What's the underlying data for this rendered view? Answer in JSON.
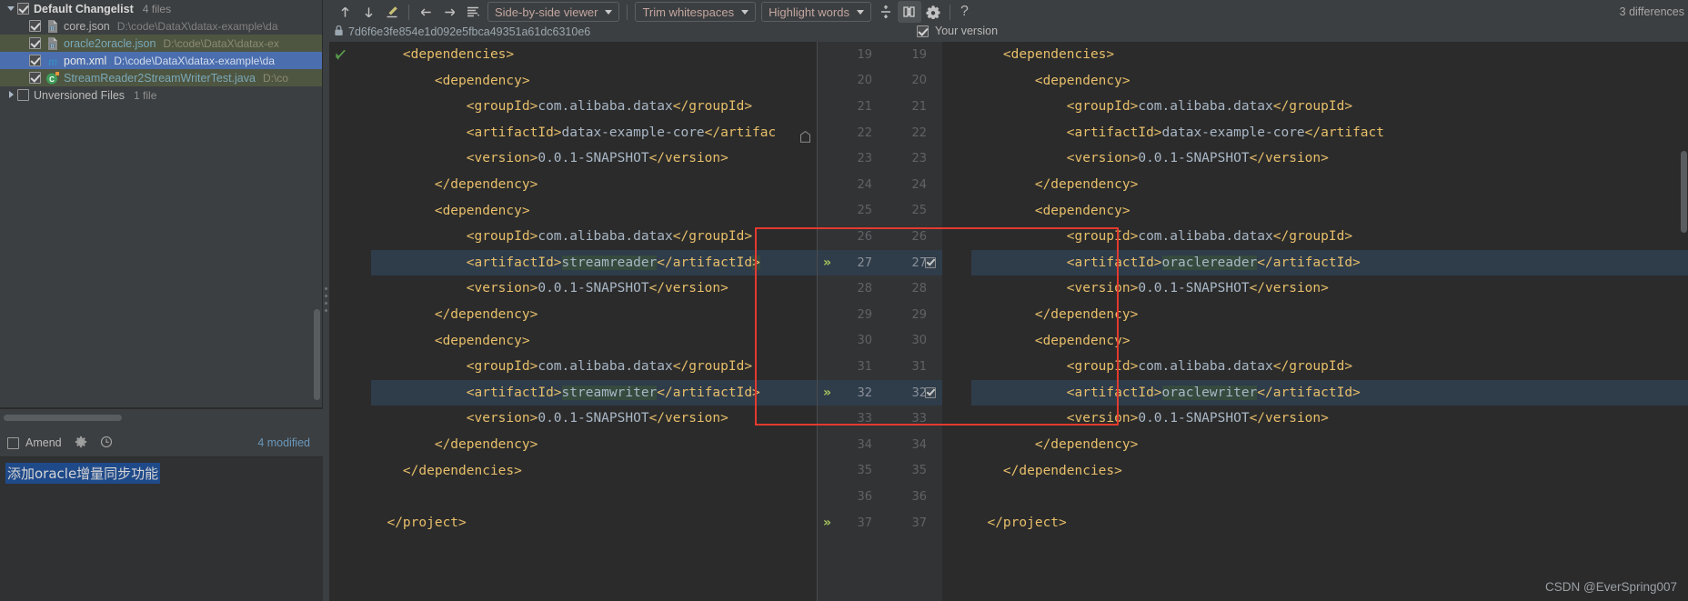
{
  "changelist": {
    "title": "Default Changelist",
    "count": "4 files",
    "expander": "chevron-down",
    "files": [
      {
        "name": "core.json",
        "path": "D:\\code\\DataX\\datax-example\\da",
        "icon": "json-file-icon",
        "state": "normal",
        "checked": true
      },
      {
        "name": "oracle2oracle.json",
        "path": "D:\\code\\DataX\\datax-ex",
        "icon": "json-file-icon",
        "state": "green",
        "checked": true
      },
      {
        "name": "pom.xml",
        "path": "D:\\code\\DataX\\datax-example\\da",
        "icon": "maven-file-icon",
        "state": "selected",
        "checked": true
      },
      {
        "name": "StreamReader2StreamWriterTest.java",
        "path": "D:\\co",
        "icon": "java-class-icon",
        "state": "green",
        "checked": true
      }
    ],
    "unversioned": {
      "label": "Unversioned Files",
      "count": "1 file",
      "expander": "chevron-right",
      "checked": false
    }
  },
  "commit": {
    "amend_label": "Amend",
    "amend_checked": false,
    "gear_icon": "gear-icon",
    "history_icon": "clock-icon",
    "modified_text": "4 modified",
    "message": "添加oracle增量同步功能"
  },
  "toolbar": {
    "prev_diff_icon": "arrow-up-icon",
    "next_diff_icon": "arrow-down-icon",
    "edit_icon": "pencil-icon",
    "back_icon": "arrow-left-icon",
    "forward_icon": "arrow-right-icon",
    "lines_icon": "list-lines-icon",
    "viewer_mode": "Side-by-side viewer",
    "whitespace_mode": "Trim whitespaces",
    "highlight_mode": "Highlight words",
    "collapse_icon": "collapse-unchanged-icon",
    "columns_icon": "synchronize-scroll-icon",
    "settings_icon": "gear-icon",
    "help_icon": "help-icon",
    "differences": "3 differences"
  },
  "diff_header": {
    "left_revision": "7d6f6e3fe854e1d092e5fbca49351a61dc6310e6",
    "left_lock_icon": "lock-icon",
    "right_label": "Your version",
    "right_checked": true
  },
  "diff": {
    "left_lines": [
      {
        "num": "19",
        "indent": 2,
        "segs": [
          {
            "t": "tag",
            "v": "<dependencies>"
          }
        ]
      },
      {
        "num": "20",
        "indent": 4,
        "segs": [
          {
            "t": "tag",
            "v": "<dependency>"
          }
        ]
      },
      {
        "num": "21",
        "indent": 6,
        "segs": [
          {
            "t": "tag",
            "v": "<groupId>"
          },
          {
            "t": "txt",
            "v": "com.alibaba.datax"
          },
          {
            "t": "tag",
            "v": "</groupId>"
          }
        ]
      },
      {
        "num": "22",
        "indent": 6,
        "segs": [
          {
            "t": "tag",
            "v": "<artifactId>"
          },
          {
            "t": "txt",
            "v": "datax-example-core"
          },
          {
            "t": "tag",
            "v": "</artifac"
          }
        ]
      },
      {
        "num": "23",
        "indent": 6,
        "segs": [
          {
            "t": "tag",
            "v": "<version>"
          },
          {
            "t": "txt",
            "v": "0.0.1-SNAPSHOT"
          },
          {
            "t": "tag",
            "v": "</version>"
          }
        ]
      },
      {
        "num": "24",
        "indent": 4,
        "segs": [
          {
            "t": "tag",
            "v": "</dependency>"
          }
        ]
      },
      {
        "num": "25",
        "indent": 4,
        "segs": [
          {
            "t": "tag",
            "v": "<dependency>"
          }
        ]
      },
      {
        "num": "26",
        "indent": 6,
        "segs": [
          {
            "t": "tag",
            "v": "<groupId>"
          },
          {
            "t": "txt",
            "v": "com.alibaba.datax"
          },
          {
            "t": "tag",
            "v": "</groupId>"
          }
        ]
      },
      {
        "num": "27",
        "indent": 6,
        "changed": true,
        "segs": [
          {
            "t": "tag",
            "v": "<artifactId>"
          },
          {
            "t": "txt",
            "v": "streamreader",
            "mark": true
          },
          {
            "t": "tag",
            "v": "</artifactId"
          },
          {
            "t": "tag",
            "v": ">",
            "mark": true
          }
        ]
      },
      {
        "num": "28",
        "indent": 6,
        "segs": [
          {
            "t": "tag",
            "v": "<version>"
          },
          {
            "t": "txt",
            "v": "0.0.1-SNAPSHOT"
          },
          {
            "t": "tag",
            "v": "</version>"
          }
        ]
      },
      {
        "num": "29",
        "indent": 4,
        "segs": [
          {
            "t": "tag",
            "v": "</dependency>"
          }
        ]
      },
      {
        "num": "30",
        "indent": 4,
        "segs": [
          {
            "t": "tag",
            "v": "<dependency>"
          }
        ]
      },
      {
        "num": "31",
        "indent": 6,
        "segs": [
          {
            "t": "tag",
            "v": "<groupId>"
          },
          {
            "t": "txt",
            "v": "com.alibaba.datax"
          },
          {
            "t": "tag",
            "v": "</groupId>"
          }
        ]
      },
      {
        "num": "32",
        "indent": 6,
        "changed": true,
        "segs": [
          {
            "t": "tag",
            "v": "<artifactId>"
          },
          {
            "t": "txt",
            "v": "streamwriter",
            "mark": true
          },
          {
            "t": "tag",
            "v": "</artifactId>"
          }
        ]
      },
      {
        "num": "33",
        "indent": 6,
        "segs": [
          {
            "t": "tag",
            "v": "<version>"
          },
          {
            "t": "txt",
            "v": "0.0.1-SNAPSHOT"
          },
          {
            "t": "tag",
            "v": "</version>"
          }
        ]
      },
      {
        "num": "34",
        "indent": 4,
        "segs": [
          {
            "t": "tag",
            "v": "</dependency>"
          }
        ]
      },
      {
        "num": "35",
        "indent": 2,
        "segs": [
          {
            "t": "tag",
            "v": "</dependencies>"
          }
        ]
      },
      {
        "num": "36",
        "indent": 0,
        "segs": []
      },
      {
        "num": "37",
        "indent": 1,
        "segs": [
          {
            "t": "tag",
            "v": "</project>"
          }
        ]
      }
    ],
    "right_lines": [
      {
        "num": "19",
        "indent": 2,
        "segs": [
          {
            "t": "tag",
            "v": "<dependencies>"
          }
        ]
      },
      {
        "num": "20",
        "indent": 4,
        "segs": [
          {
            "t": "tag",
            "v": "<dependency>"
          }
        ]
      },
      {
        "num": "21",
        "indent": 6,
        "segs": [
          {
            "t": "tag",
            "v": "<groupId>"
          },
          {
            "t": "txt",
            "v": "com.alibaba.datax"
          },
          {
            "t": "tag",
            "v": "</groupId>"
          }
        ]
      },
      {
        "num": "22",
        "indent": 6,
        "segs": [
          {
            "t": "tag",
            "v": "<artifactId>"
          },
          {
            "t": "txt",
            "v": "datax-example-core"
          },
          {
            "t": "tag",
            "v": "</artifact"
          }
        ]
      },
      {
        "num": "23",
        "indent": 6,
        "segs": [
          {
            "t": "tag",
            "v": "<version>"
          },
          {
            "t": "txt",
            "v": "0.0.1-SNAPSHOT"
          },
          {
            "t": "tag",
            "v": "</version>"
          }
        ]
      },
      {
        "num": "24",
        "indent": 4,
        "segs": [
          {
            "t": "tag",
            "v": "</dependency>"
          }
        ]
      },
      {
        "num": "25",
        "indent": 4,
        "segs": [
          {
            "t": "tag",
            "v": "<dependency>"
          }
        ]
      },
      {
        "num": "26",
        "indent": 6,
        "segs": [
          {
            "t": "tag",
            "v": "<groupId>"
          },
          {
            "t": "txt",
            "v": "com.alibaba.datax"
          },
          {
            "t": "tag",
            "v": "</groupId>"
          }
        ]
      },
      {
        "num": "27",
        "indent": 6,
        "changed": true,
        "segs": [
          {
            "t": "tag",
            "v": "<artifactId>"
          },
          {
            "t": "txt",
            "v": "oraclereader",
            "mark": true
          },
          {
            "t": "tag",
            "v": "</artifactId>"
          }
        ]
      },
      {
        "num": "28",
        "indent": 6,
        "segs": [
          {
            "t": "tag",
            "v": "<version>"
          },
          {
            "t": "txt",
            "v": "0.0.1-SNAPSHOT"
          },
          {
            "t": "tag",
            "v": "</version>"
          }
        ]
      },
      {
        "num": "29",
        "indent": 4,
        "segs": [
          {
            "t": "tag",
            "v": "</dependency>"
          }
        ]
      },
      {
        "num": "30",
        "indent": 4,
        "segs": [
          {
            "t": "tag",
            "v": "<dependency>"
          }
        ]
      },
      {
        "num": "31",
        "indent": 6,
        "segs": [
          {
            "t": "tag",
            "v": "<groupId>"
          },
          {
            "t": "txt",
            "v": "com.alibaba.datax"
          },
          {
            "t": "tag",
            "v": "</groupId>"
          }
        ]
      },
      {
        "num": "32",
        "indent": 6,
        "changed": true,
        "segs": [
          {
            "t": "tag",
            "v": "<artifactId>"
          },
          {
            "t": "txt",
            "v": "oraclewriter",
            "mark": true
          },
          {
            "t": "tag",
            "v": "</artifactId>"
          }
        ]
      },
      {
        "num": "33",
        "indent": 6,
        "segs": [
          {
            "t": "tag",
            "v": "<version>"
          },
          {
            "t": "txt",
            "v": "0.0.1-SNAPSHOT"
          },
          {
            "t": "tag",
            "v": "</version>"
          }
        ]
      },
      {
        "num": "34",
        "indent": 4,
        "segs": [
          {
            "t": "tag",
            "v": "</dependency>"
          }
        ]
      },
      {
        "num": "35",
        "indent": 2,
        "segs": [
          {
            "t": "tag",
            "v": "</dependencies>"
          }
        ]
      },
      {
        "num": "36",
        "indent": 0,
        "segs": []
      },
      {
        "num": "37",
        "indent": 1,
        "segs": [
          {
            "t": "tag",
            "v": "</project>"
          }
        ]
      }
    ],
    "gutter_rows": [
      {
        "l": "19",
        "r": "19"
      },
      {
        "l": "20",
        "r": "20"
      },
      {
        "l": "21",
        "r": "21"
      },
      {
        "l": "22",
        "r": "22"
      },
      {
        "l": "23",
        "r": "23"
      },
      {
        "l": "24",
        "r": "24"
      },
      {
        "l": "25",
        "r": "25"
      },
      {
        "l": "26",
        "r": "26"
      },
      {
        "l": "27",
        "r": "27",
        "changed": true,
        "mark": "»",
        "check": true
      },
      {
        "l": "28",
        "r": "28"
      },
      {
        "l": "29",
        "r": "29"
      },
      {
        "l": "30",
        "r": "30"
      },
      {
        "l": "31",
        "r": "31"
      },
      {
        "l": "32",
        "r": "32",
        "changed": true,
        "mark": "»",
        "check": true
      },
      {
        "l": "33",
        "r": "33"
      },
      {
        "l": "34",
        "r": "34"
      },
      {
        "l": "35",
        "r": "35"
      },
      {
        "l": "36",
        "r": "36"
      },
      {
        "l": "37",
        "r": "37",
        "mark": "»"
      }
    ]
  },
  "watermark": "CSDN @EverSpring007",
  "colors": {
    "tag": "#e8bf6a",
    "text": "#a9b7c6",
    "changed_bg": "#2f3c4a",
    "highlight_box": "#e23a2e",
    "selection_blue": "#4b6eaf",
    "selection_green": "#4e5641"
  }
}
